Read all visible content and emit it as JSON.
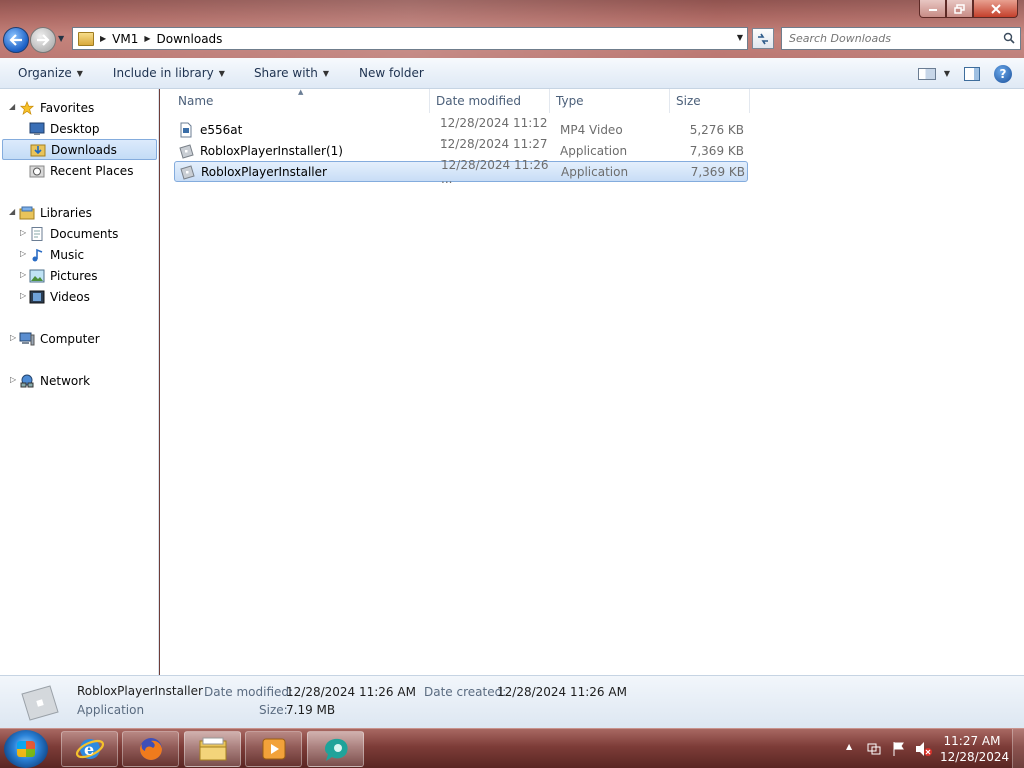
{
  "window": {
    "breadcrumb": [
      "VM1",
      "Downloads"
    ],
    "search_placeholder": "Search Downloads"
  },
  "toolbar": {
    "organize": "Organize",
    "include_in_library": "Include in library",
    "share_with": "Share with",
    "new_folder": "New folder"
  },
  "navpane": {
    "favorites": "Favorites",
    "desktop": "Desktop",
    "downloads": "Downloads",
    "recent_places": "Recent Places",
    "libraries": "Libraries",
    "documents": "Documents",
    "music": "Music",
    "pictures": "Pictures",
    "videos": "Videos",
    "computer": "Computer",
    "network": "Network"
  },
  "columns": {
    "name": "Name",
    "date_modified": "Date modified",
    "type": "Type",
    "size": "Size"
  },
  "files": [
    {
      "name": "e556at",
      "date": "12/28/2024 11:12 ...",
      "type": "MP4 Video",
      "size": "5,276 KB",
      "icon": "video-file-icon"
    },
    {
      "name": "RobloxPlayerInstaller(1)",
      "date": "12/28/2024 11:27 ...",
      "type": "Application",
      "size": "7,369 KB",
      "icon": "application-icon"
    },
    {
      "name": "RobloxPlayerInstaller",
      "date": "12/28/2024 11:26 ...",
      "type": "Application",
      "size": "7,369 KB",
      "icon": "application-icon",
      "selected": true
    }
  ],
  "details": {
    "name": "RobloxPlayerInstaller",
    "type": "Application",
    "date_modified_label": "Date modified:",
    "date_modified": "12/28/2024 11:26 AM",
    "date_created_label": "Date created:",
    "date_created": "12/28/2024 11:26 AM",
    "size_label": "Size:",
    "size": "7.19 MB"
  },
  "taskbar": {
    "apps": [
      "internet-explorer-icon",
      "firefox-icon",
      "windows-explorer-icon",
      "media-player-icon",
      "app-icon"
    ],
    "time": "11:27 AM",
    "date": "12/28/2024"
  },
  "colors": {
    "selection": "#cfe3f9",
    "accent": "#2a82d8"
  }
}
